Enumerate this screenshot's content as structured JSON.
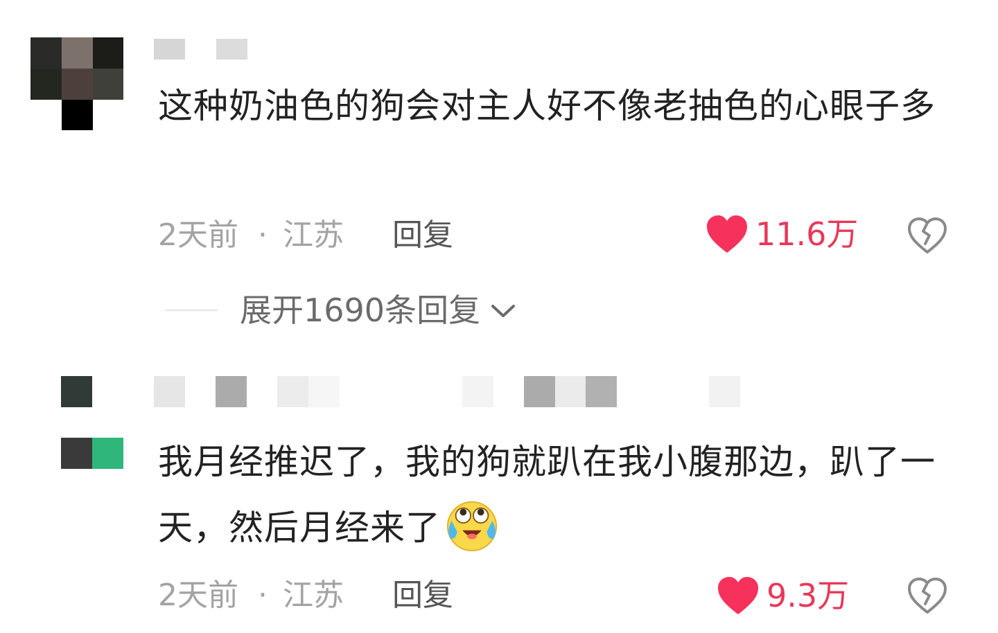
{
  "comments": [
    {
      "text": "这种奶油色的狗会对主人好不像老抽色的心眼子多",
      "time": "2天前",
      "separator": "·",
      "location": "江苏",
      "reply_label": "回复",
      "likes": "11.6万",
      "expand_label": "展开1690条回复"
    },
    {
      "text": "我月经推迟了，我的狗就趴在我小腹那边，趴了一天，然后月经来了",
      "emoji": "crying-laughing-emoji",
      "time": "2天前",
      "separator": "·",
      "location": "江苏",
      "reply_label": "回复",
      "likes": "9.3万"
    }
  ],
  "colors": {
    "like_red": "#f6325c",
    "like_text": "#e8385a",
    "meta_gray": "#a3a3a3",
    "reply_gray": "#555555"
  },
  "icons": {
    "like": "heart-icon",
    "dislike": "broken-heart-icon",
    "expand": "chevron-down-icon"
  }
}
